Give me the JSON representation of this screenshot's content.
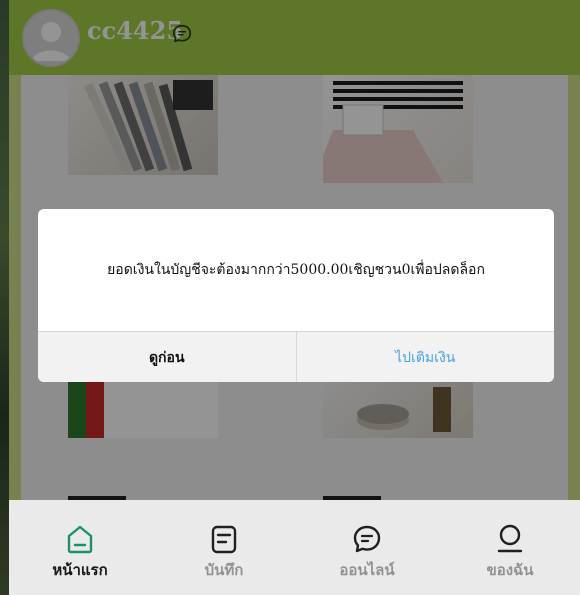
{
  "header": {
    "username": "cc4425"
  },
  "dialog": {
    "message": "ยอดเงินในบัญชีจะต้องมากกว่า5000.00เชิญชวน0เพื่อปลดล็อก",
    "cancel_label": "ดูก่อน",
    "confirm_label": "ไปเติมเงิน"
  },
  "bottom_nav": {
    "items": [
      {
        "label": "หน้าแรก",
        "icon": "home-icon",
        "active": true
      },
      {
        "label": "บันทึก",
        "icon": "record-icon",
        "active": false
      },
      {
        "label": "ออนไลน์",
        "icon": "chat-bubble-icon",
        "active": false
      },
      {
        "label": "ของฉัน",
        "icon": "profile-icon",
        "active": false
      }
    ]
  },
  "colors": {
    "header_bg": "#a3cc45",
    "accent_link": "#4aa3df",
    "active_nav_icon": "#1f9a6a"
  }
}
